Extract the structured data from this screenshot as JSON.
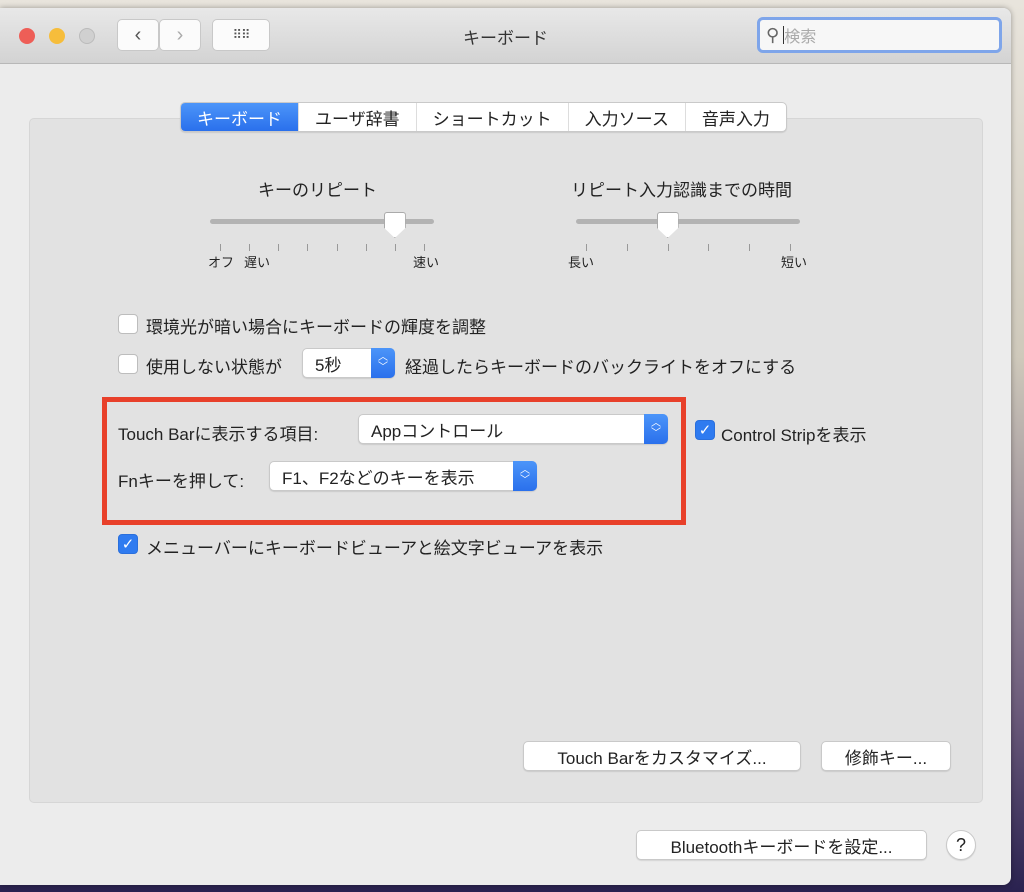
{
  "window": {
    "title": "キーボード",
    "search_placeholder": "検索"
  },
  "tabs": [
    {
      "label": "キーボード",
      "active": true
    },
    {
      "label": "ユーザ辞書"
    },
    {
      "label": "ショートカット"
    },
    {
      "label": "入力ソース"
    },
    {
      "label": "音声入力"
    }
  ],
  "key_repeat": {
    "title": "キーのリピート",
    "min_label": "オフ",
    "slow_label": "遅い",
    "max_label": "速い",
    "value_fraction": 0.857
  },
  "delay_until_repeat": {
    "title": "リピート入力認識までの時間",
    "min_label": "長い",
    "max_label": "短い",
    "value_fraction": 0.4
  },
  "ambient_light": {
    "label": "環境光が暗い場合にキーボードの輝度を調整",
    "checked": false
  },
  "backlight_off": {
    "prefix": "使用しない状態が",
    "value": "5秒",
    "suffix": "経過したらキーボードのバックライトをオフにする",
    "checked": false
  },
  "touch_bar": {
    "label": "Touch Barに表示する項目:",
    "value": "Appコントロール"
  },
  "control_strip": {
    "label": "Control Stripを表示",
    "checked": true
  },
  "fn_key": {
    "label": "Fnキーを押して:",
    "value": "F1、F2などのキーを表示"
  },
  "menu_bar_viewer": {
    "label": "メニューバーにキーボードビューアと絵文字ビューアを表示",
    "checked": true
  },
  "buttons": {
    "customize_touch_bar": "Touch Barをカスタマイズ...",
    "modifier_keys": "修飾キー...",
    "bluetooth": "Bluetoothキーボードを設定...",
    "help": "?"
  },
  "colors": {
    "accent": "#2f7bf0",
    "highlight_box": "#e8402a"
  }
}
